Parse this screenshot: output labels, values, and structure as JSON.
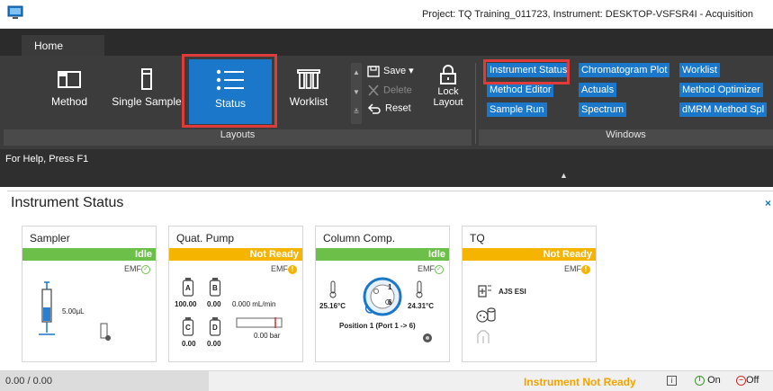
{
  "window": {
    "title": "Project: TQ Training_011723, Instrument: DESKTOP-VSFSR4I - Acquisition"
  },
  "ribbon": {
    "tabs": [
      {
        "label": "Home"
      }
    ],
    "layouts": {
      "buttons": [
        {
          "label": "Method",
          "icon": "method-icon"
        },
        {
          "label": "Single Sample",
          "icon": "single-sample-icon"
        },
        {
          "label": "Status",
          "icon": "status-list-icon",
          "selected": true
        },
        {
          "label": "Worklist",
          "icon": "worklist-icon"
        }
      ],
      "save_label": "Save",
      "delete_label": "Delete",
      "reset_label": "Reset",
      "lock_label_1": "Lock",
      "lock_label_2": "Layout",
      "group_label": "Layouts"
    },
    "windows": {
      "links": [
        "Instrument Status",
        "Chromatogram Plot",
        "Worklist",
        "Method Editor",
        "Actuals",
        "Method Optimizer",
        "Sample Run",
        "Spectrum",
        "dMRM Method Spl"
      ],
      "group_label": "Windows"
    },
    "accent_color": "#1a77c9",
    "highlight_color": "#e03b3b"
  },
  "help": {
    "text": "For Help, Press F1"
  },
  "instrument_status": {
    "title": "Instrument Status",
    "close_glyph": "×",
    "modules": [
      {
        "name": "Sampler",
        "status": "Idle",
        "status_color": "#6cc04a",
        "emf": "EMF",
        "emf_state": "ok",
        "volume": "5.00µL"
      },
      {
        "name": "Quat. Pump",
        "status": "Not Ready",
        "status_color": "#f5b400",
        "emf": "EMF",
        "emf_state": "warn",
        "bottles": [
          {
            "label": "A",
            "value": "100.00"
          },
          {
            "label": "B",
            "value": "0.00"
          },
          {
            "label": "C",
            "value": "0.00"
          },
          {
            "label": "D",
            "value": "0.00"
          }
        ],
        "flow": "0.000 mL/min",
        "pressure": "0.00 bar"
      },
      {
        "name": "Column Comp.",
        "status": "Idle",
        "status_color": "#6cc04a",
        "emf": "EMF",
        "emf_state": "ok",
        "temp_left": "25.16°C",
        "temp_right": "24.31°C",
        "valve_port_1": "1",
        "valve_port_6": "6",
        "position": "Position 1 (Port 1 -> 6)"
      },
      {
        "name": "TQ",
        "status": "Not Ready",
        "status_color": "#f5b400",
        "emf": "EMF",
        "emf_state": "warn",
        "source": "AJS ESI"
      }
    ]
  },
  "statusbar": {
    "progress": "0.00 / 0.00",
    "warning": "Instrument Not Ready",
    "info_glyph": "i",
    "on_label": "On",
    "off_label": "Off"
  }
}
